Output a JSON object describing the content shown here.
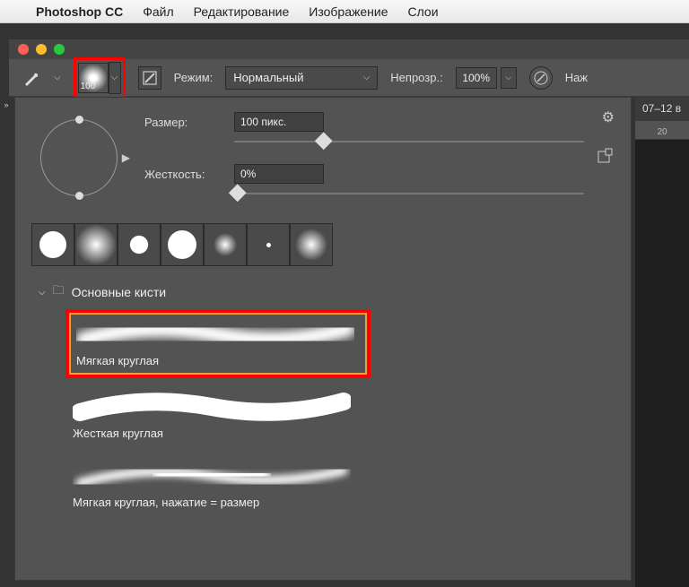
{
  "menubar": {
    "app": "Photoshop CC",
    "items": [
      "Файл",
      "Редактирование",
      "Изображение",
      "Слои"
    ]
  },
  "optbar": {
    "brush_size_num": "100",
    "mode_label": "Режим:",
    "mode_value": "Нормальный",
    "opacity_label": "Непрозр.:",
    "opacity_value": "100%",
    "flow_label_partial": "Наж"
  },
  "doc_tab_partial": "07–12 в",
  "ruler_tick": "20",
  "brush_panel": {
    "size_label": "Размер:",
    "size_value": "100 пикс.",
    "hardness_label": "Жесткость:",
    "hardness_value": "0%",
    "category": "Основные кисти",
    "brushes": [
      {
        "name": "Мягкая круглая"
      },
      {
        "name": "Жесткая круглая"
      },
      {
        "name": "Мягкая круглая, нажатие = размер"
      }
    ]
  }
}
